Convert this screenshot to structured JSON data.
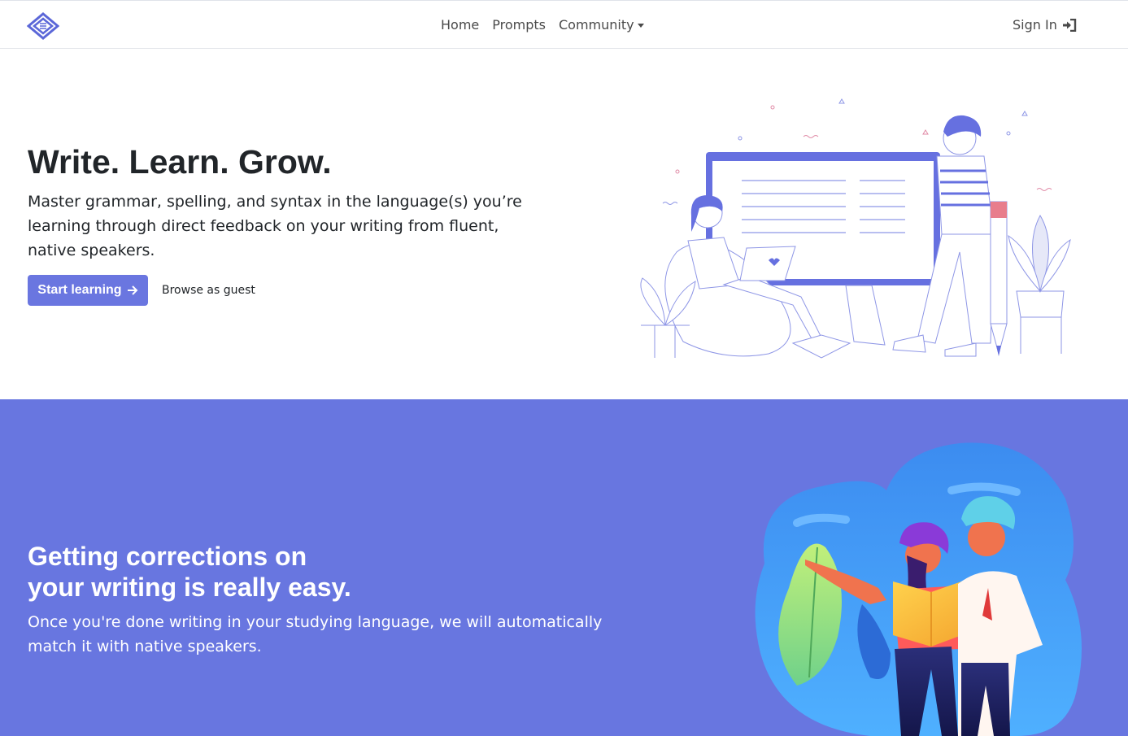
{
  "nav": {
    "links": [
      {
        "label": "Home"
      },
      {
        "label": "Prompts"
      },
      {
        "label": "Community"
      }
    ],
    "signin_label": "Sign In"
  },
  "hero": {
    "title": "Write. Learn. Grow.",
    "text": "Master grammar, spelling, and syntax in the language(s) you’re learning through direct feedback on your writing from fluent, native speakers.",
    "start_label": "Start learning",
    "guest_label": "Browse as guest"
  },
  "feature": {
    "title_line1": "Getting corrections on",
    "title_line2": "your writing is really easy.",
    "text": "Once you're done writing in your studying language, we will automatically match it with native speakers."
  },
  "colors": {
    "accent": "#6a76e0",
    "band_bg": "#6876e0",
    "text_dark": "#212529",
    "nav_text": "#4a4a4a"
  },
  "icons": {
    "logo": "diamond-logo-icon",
    "signin": "sign-in-icon",
    "start_arrow": "arrow-right-icon",
    "community_dropdown": "caret-down-icon"
  }
}
